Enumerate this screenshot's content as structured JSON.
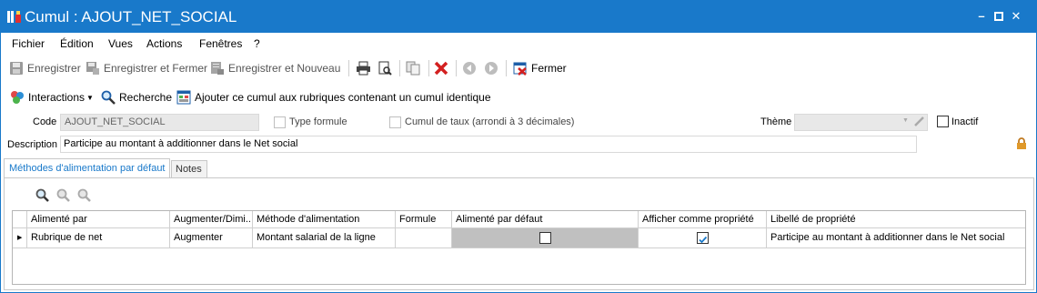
{
  "window": {
    "title": "Cumul : AJOUT_NET_SOCIAL"
  },
  "menu": [
    "Fichier",
    "Édition",
    "Vues",
    "Actions",
    "Fenêtres",
    "?"
  ],
  "toolbar": {
    "save": "Enregistrer",
    "save_close": "Enregistrer et Fermer",
    "save_new": "Enregistrer et Nouveau",
    "close": "Fermer"
  },
  "toolbar2": {
    "interactions": "Interactions",
    "search": "Recherche",
    "add_cumul": "Ajouter ce cumul aux rubriques contenant un cumul identique"
  },
  "form": {
    "code_label": "Code",
    "code_value": "AJOUT_NET_SOCIAL",
    "type_formule_label": "Type formule",
    "type_formule_checked": false,
    "cumul_taux_label": "Cumul de taux (arrondi à 3 décimales)",
    "cumul_taux_checked": false,
    "theme_label": "Thème",
    "theme_value": "",
    "inactif_label": "Inactif",
    "inactif_checked": false,
    "description_label": "Description",
    "description_value": "Participe au montant à additionner dans le Net social"
  },
  "tabs": [
    {
      "label": "Méthodes d'alimentation par défaut",
      "active": true
    },
    {
      "label": "Notes",
      "active": false
    }
  ],
  "grid": {
    "columns": [
      "Alimenté par",
      "Augmenter/Dimi...",
      "Méthode d'alimentation",
      "Formule",
      "Alimenté par défaut",
      "Afficher comme propriété",
      "Libellé de propriété"
    ],
    "rows": [
      {
        "alimente_par": "Rubrique de net",
        "augmenter": "Augmenter",
        "methode": "Montant salarial de la ligne",
        "formule": "",
        "alimente_defaut": false,
        "afficher_propriete": true,
        "libelle": "Participe au montant à additionner dans le Net social"
      }
    ]
  },
  "colors": {
    "accent": "#1979ca",
    "disabled_cell": "#c0c0c0",
    "delete": "#d32020"
  }
}
